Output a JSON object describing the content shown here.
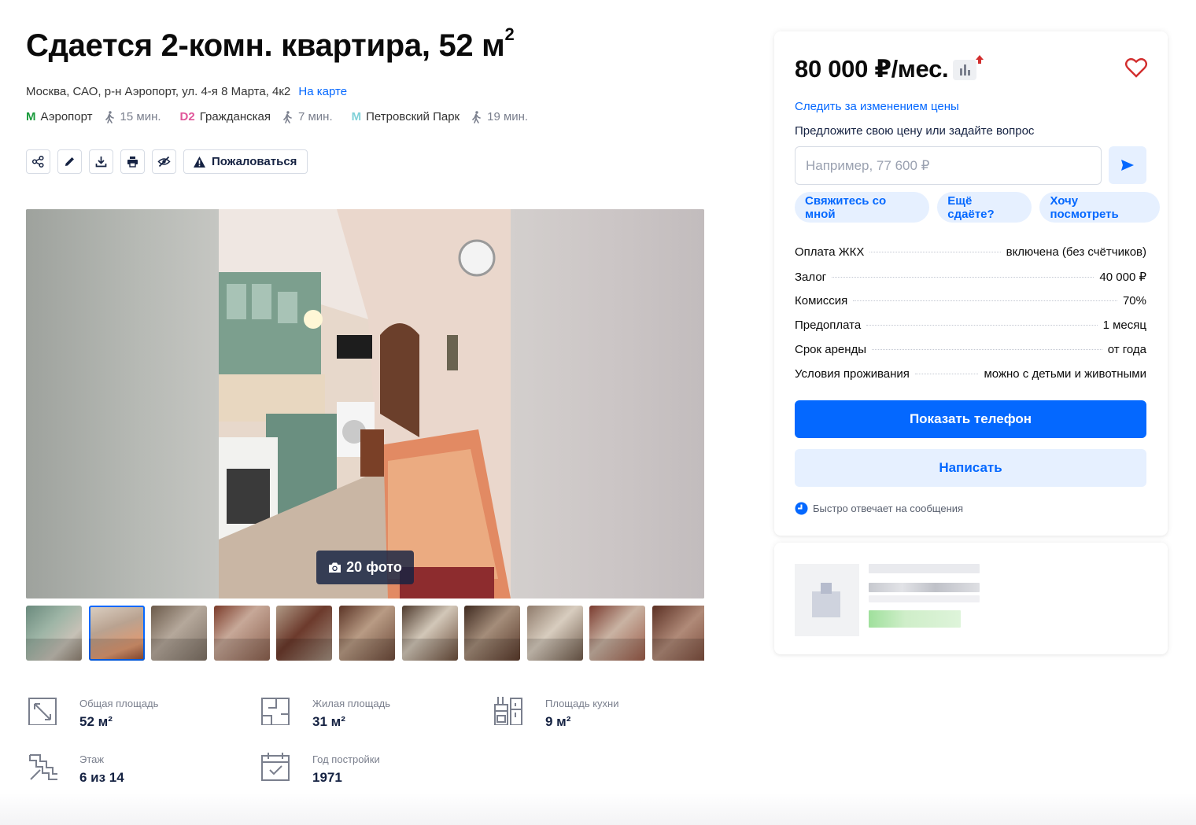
{
  "listing": {
    "title": "Сдается 2-комн. квартира, 52 м",
    "title_sup": "2",
    "address": "Москва, САО, р-н Аэропорт, ул. 4-я 8 Марта, 4к2",
    "map_link": "На карте",
    "metro": [
      {
        "icon": "M",
        "name": "Аэропорт",
        "walk": "15 мин.",
        "color": "#1a9b3c"
      },
      {
        "icon": "D2",
        "name": "Гражданская",
        "walk": "7 мин.",
        "color": "#e0569a"
      },
      {
        "icon": "M",
        "name": "Петровский Парк",
        "walk": "19 мин.",
        "color": "#7fd1d8"
      }
    ]
  },
  "toolbar": {
    "icons": [
      "share-icon",
      "edit-icon",
      "download-icon",
      "print-icon",
      "hide-icon"
    ],
    "complain_label": "Пожаловаться"
  },
  "gallery": {
    "counter_label": "20 фото",
    "thumbnail_count": 11,
    "active_thumbnail": 2
  },
  "facts": [
    {
      "label": "Общая площадь",
      "value": "52 м²",
      "icon": "area-icon"
    },
    {
      "label": "Жилая площадь",
      "value": "31 м²",
      "icon": "living-area-icon"
    },
    {
      "label": "Площадь кухни",
      "value": "9 м²",
      "icon": "kitchen-icon"
    },
    {
      "label": "Этаж",
      "value": "6 из 14",
      "icon": "floor-icon"
    },
    {
      "label": "Год постройки",
      "value": "1971",
      "icon": "calendar-icon"
    }
  ],
  "offer": {
    "price": "80 000 ₽/мес.",
    "track_price_link": "Следить за изменением цены",
    "caption": "Предложите свою цену или задайте вопрос",
    "input_placeholder": "Например, 77 600 ₽",
    "input_value": "",
    "quick_replies": [
      "Свяжитесь со мной",
      "Ещё сдаёте?",
      "Хочу посмотреть"
    ],
    "terms": [
      {
        "label": "Оплата ЖКХ",
        "value": "включена (без счётчиков)"
      },
      {
        "label": "Залог",
        "value": "40 000 ₽"
      },
      {
        "label": "Комиссия",
        "value": "70%"
      },
      {
        "label": "Предоплата",
        "value": "1 месяц"
      },
      {
        "label": "Срок аренды",
        "value": "от года"
      },
      {
        "label": "Условия проживания",
        "value": "можно с детьми и животными"
      }
    ],
    "show_phone_label": "Показать телефон",
    "write_label": "Написать",
    "fast_reply_note": "Быстро отвечает на сообщения"
  },
  "colors": {
    "accent": "#0468ff",
    "accent_light": "#e6f0ff",
    "text": "#152242",
    "favorite": "#d22e2e"
  }
}
